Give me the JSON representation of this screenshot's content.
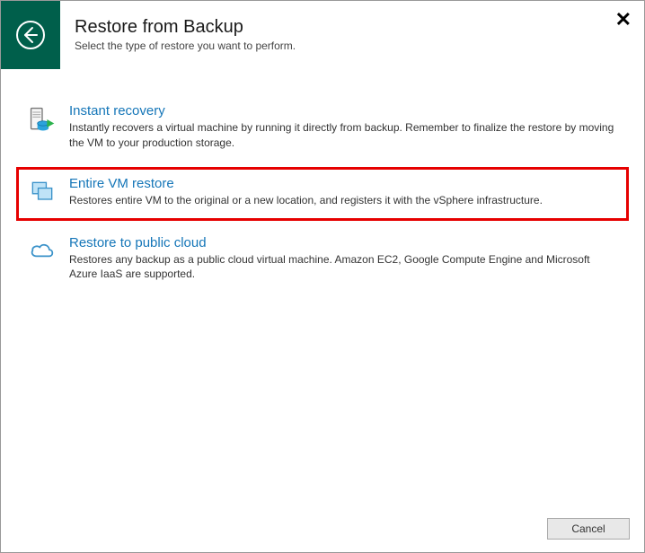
{
  "header": {
    "title": "Restore from Backup",
    "subtitle": "Select the type of restore you want to perform."
  },
  "options": [
    {
      "title": "Instant recovery",
      "description": "Instantly recovers a virtual machine by running it directly from backup. Remember to finalize the restore by moving the VM to your production storage."
    },
    {
      "title": "Entire VM restore",
      "description": "Restores entire VM to the original or a new location, and registers it with the vSphere infrastructure."
    },
    {
      "title": "Restore to public cloud",
      "description": "Restores any backup as a public cloud virtual machine. Amazon EC2, Google Compute Engine and Microsoft Azure IaaS are supported."
    }
  ],
  "footer": {
    "cancel_label": "Cancel"
  }
}
